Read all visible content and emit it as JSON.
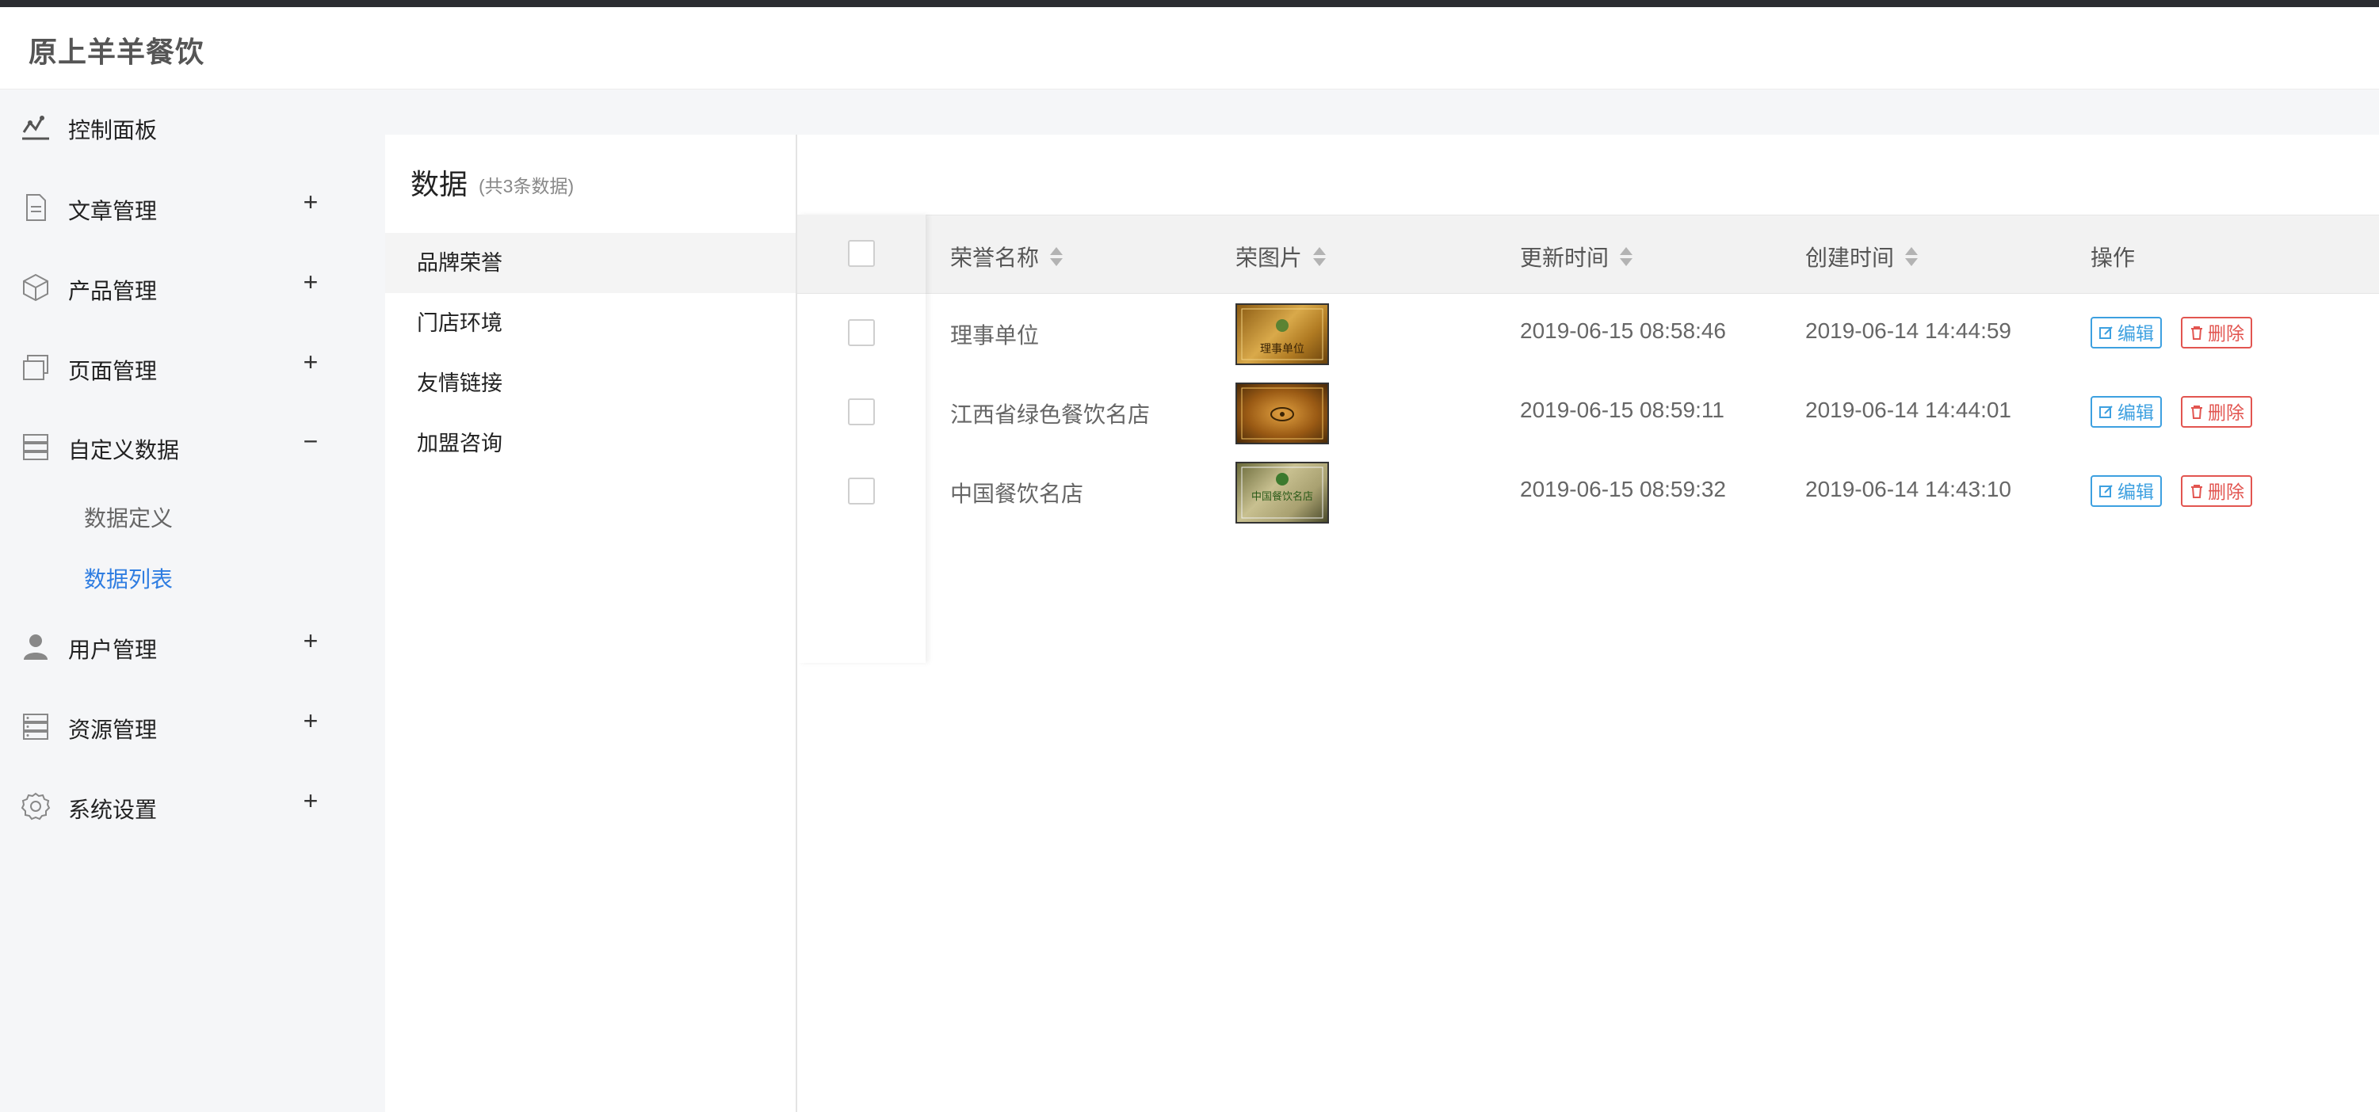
{
  "header": {
    "brand": "原上羊羊餐饮"
  },
  "sidebar": {
    "items": [
      {
        "label": "控制面板",
        "icon": "dashboard-chart-icon",
        "toggle": ""
      },
      {
        "label": "文章管理",
        "icon": "document-icon",
        "toggle": "+"
      },
      {
        "label": "产品管理",
        "icon": "box-icon",
        "toggle": "+"
      },
      {
        "label": "页面管理",
        "icon": "pages-icon",
        "toggle": "+"
      },
      {
        "label": "自定义数据",
        "icon": "data-stack-icon",
        "toggle": "−"
      },
      {
        "label": "用户管理",
        "icon": "user-icon",
        "toggle": "+"
      },
      {
        "label": "资源管理",
        "icon": "server-icon",
        "toggle": "+"
      },
      {
        "label": "系统设置",
        "icon": "gear-icon",
        "toggle": "+"
      }
    ],
    "sub_items": [
      {
        "label": "数据定义",
        "active": false
      },
      {
        "label": "数据列表",
        "active": true
      }
    ]
  },
  "data_panel": {
    "title": "数据",
    "count": "(共3条数据)",
    "items": [
      "品牌荣誉",
      "门店环境",
      "友情链接",
      "加盟咨询"
    ],
    "active_index": 0
  },
  "table": {
    "columns": [
      "荣誉名称",
      "荣图片",
      "更新时间",
      "创建时间",
      "操作"
    ],
    "rows": [
      {
        "name": "理事单位",
        "image_text": "理事单位",
        "updated": "2019-06-15 08:58:46",
        "created": "2019-06-14 14:44:59"
      },
      {
        "name": "江西省绿色餐饮名店",
        "image_text": "",
        "updated": "2019-06-15 08:59:11",
        "created": "2019-06-14 14:44:01"
      },
      {
        "name": "中国餐饮名店",
        "image_text": "中国餐饮名店",
        "updated": "2019-06-15 08:59:32",
        "created": "2019-06-14 14:43:10"
      }
    ],
    "edit_label": "编辑",
    "delete_label": "删除"
  },
  "colors": {
    "accent": "#2f7de1",
    "edit": "#3da0e0",
    "delete": "#e25550"
  }
}
